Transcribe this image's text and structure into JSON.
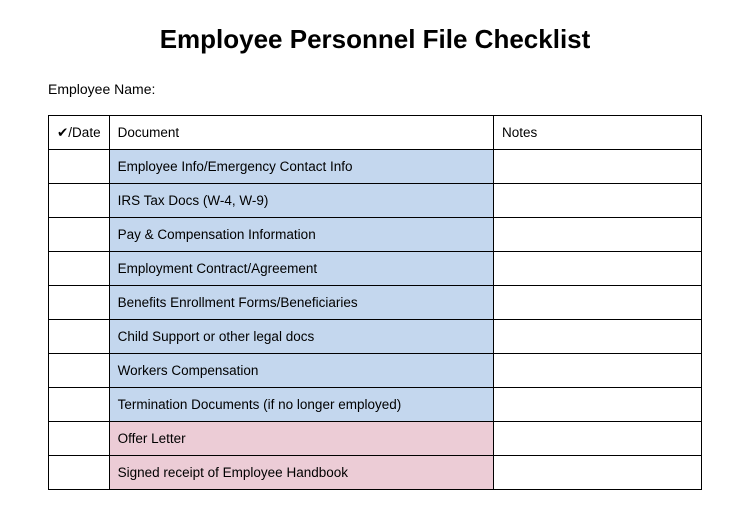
{
  "title": "Employee Personnel File Checklist",
  "employee_name_label": "Employee Name:",
  "table": {
    "headers": {
      "check": "✔/Date",
      "document": "Document",
      "notes": "Notes"
    },
    "rows": [
      {
        "check": "",
        "document": "Employee Info/Emergency Contact Info",
        "notes": "",
        "color": "blue"
      },
      {
        "check": "",
        "document": "IRS Tax Docs (W-4, W-9)",
        "notes": "",
        "color": "blue"
      },
      {
        "check": "",
        "document": "Pay & Compensation Information",
        "notes": "",
        "color": "blue"
      },
      {
        "check": "",
        "document": "Employment Contract/Agreement",
        "notes": "",
        "color": "blue"
      },
      {
        "check": "",
        "document": "Benefits Enrollment Forms/Beneficiaries",
        "notes": "",
        "color": "blue"
      },
      {
        "check": "",
        "document": "Child Support or other legal docs",
        "notes": "",
        "color": "blue"
      },
      {
        "check": "",
        "document": "Workers Compensation",
        "notes": "",
        "color": "blue"
      },
      {
        "check": "",
        "document": "Termination Documents (if no longer employed)",
        "notes": "",
        "color": "blue"
      },
      {
        "check": "",
        "document": "Offer Letter",
        "notes": "",
        "color": "pink"
      },
      {
        "check": "",
        "document": "Signed receipt of Employee Handbook",
        "notes": "",
        "color": "pink"
      }
    ]
  }
}
